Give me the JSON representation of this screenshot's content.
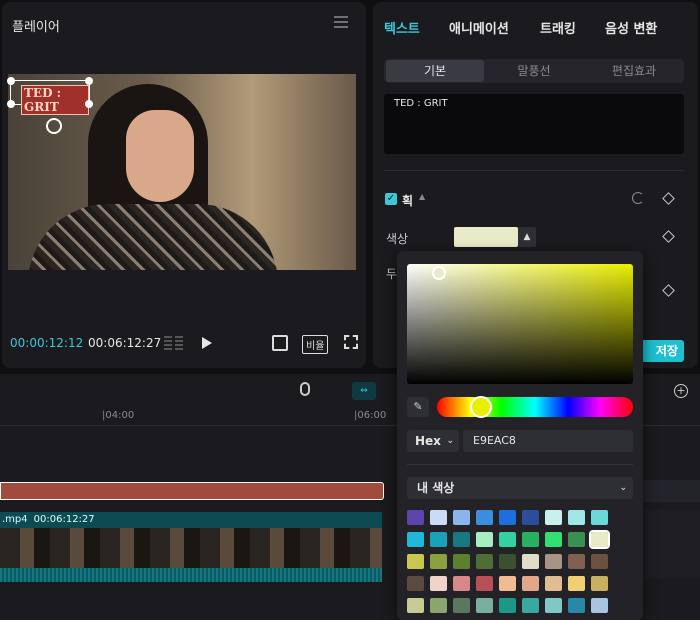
{
  "player": {
    "title": "플레이어",
    "overlay_text": "TED : GRIT",
    "time_current": "00:00:12:12",
    "time_total": "00:06:12:27",
    "ratio_label": "비율"
  },
  "properties": {
    "tabs": [
      "텍스트",
      "애니메이션",
      "트래킹",
      "음성 변환"
    ],
    "subtabs": [
      "기본",
      "말풍선",
      "편집효과"
    ],
    "text_value": "TED : GRIT",
    "stroke_label": "획",
    "color_label": "색상",
    "thickness_label": "두",
    "save_label": "저장"
  },
  "timeline": {
    "ticks": [
      "|04:00",
      "|06:00"
    ],
    "clip_name": ".mp4",
    "clip_duration": "00:06:12:27"
  },
  "picker": {
    "hex_mode": "Hex",
    "hex_value": "E9EAC8",
    "selected_color": "#E9EAC8",
    "palette_label": "내 색상",
    "swatches": [
      "#5a46a8",
      "#c8dcf4",
      "#8cb4ec",
      "#3c8ce0",
      "#1f6ee0",
      "#2a4e9c",
      "#c8f0ee",
      "#a0e8e8",
      "#6cd8d8",
      "#20b8d8",
      "#1aa0b8",
      "#1a7880",
      "#a8ecc4",
      "#34d0a0",
      "#28b060",
      "#30e070",
      "#3a9050",
      "#E9EAC8",
      "#c8c850",
      "#8ca040",
      "#5a8030",
      "#4e6e38",
      "#3c5030",
      "#e0dccc",
      "#a89484",
      "#806050",
      "#6c5040",
      "#5c4c40",
      "#f0d4cc",
      "#d88888",
      "#b85058",
      "#f0bc94",
      "#e0a888",
      "#e0bc90",
      "#f0d070",
      "#c8b060",
      "#c8cc94",
      "#8ca470",
      "#5a7860",
      "#78b0a0",
      "#1a9888",
      "#38a8a0",
      "#80c8c8",
      "#2888a8",
      "#a8c4e0"
    ]
  },
  "colors": {
    "accent": "#1ec0d0",
    "panel": "#1b1b1f",
    "text_track": "#a24a3c",
    "video_track": "#0d4a52"
  }
}
